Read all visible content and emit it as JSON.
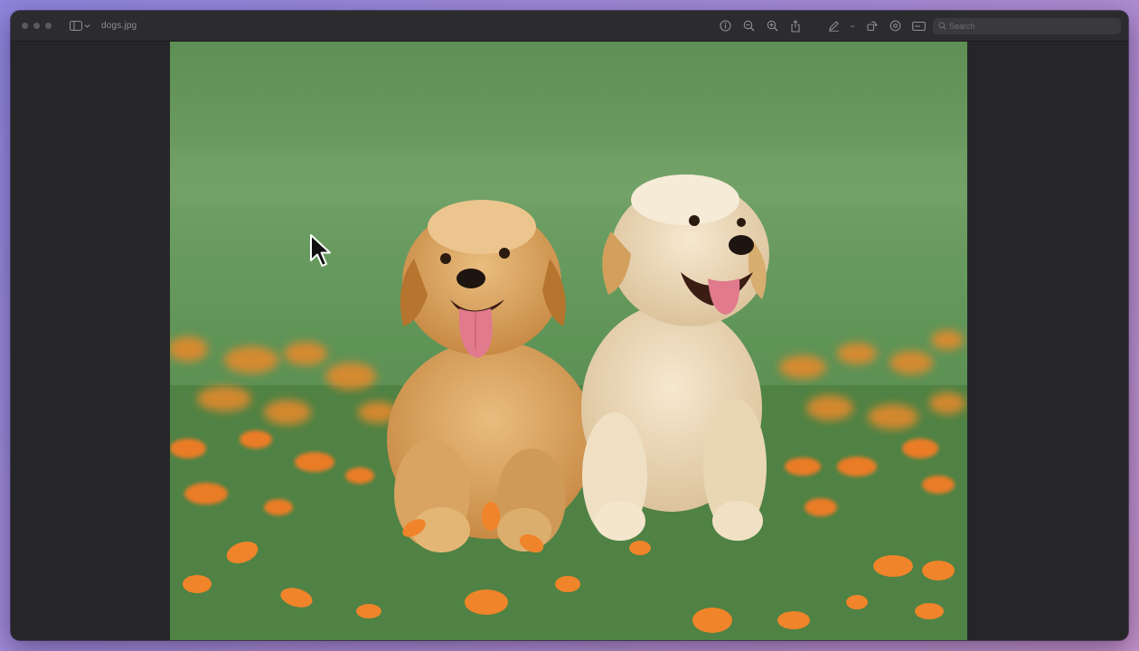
{
  "window": {
    "title": "dogs.jpg",
    "search": {
      "placeholder": "Search",
      "value": ""
    }
  },
  "toolbar": {
    "tools": [
      {
        "name": "info-icon"
      },
      {
        "name": "zoom-out-icon"
      },
      {
        "name": "zoom-in-icon"
      },
      {
        "name": "share-icon"
      },
      {
        "name": "markup-pen-icon"
      },
      {
        "name": "rotate-icon"
      },
      {
        "name": "crop-icon"
      },
      {
        "name": "form-icon"
      }
    ]
  },
  "image": {
    "subject": "photo",
    "colors": {
      "grass": "#5b8f4f",
      "sky": "#6e9e66",
      "flowers": "#e9882a",
      "fur_left": "#d9a15d",
      "fur_right": "#eedcbd"
    }
  }
}
